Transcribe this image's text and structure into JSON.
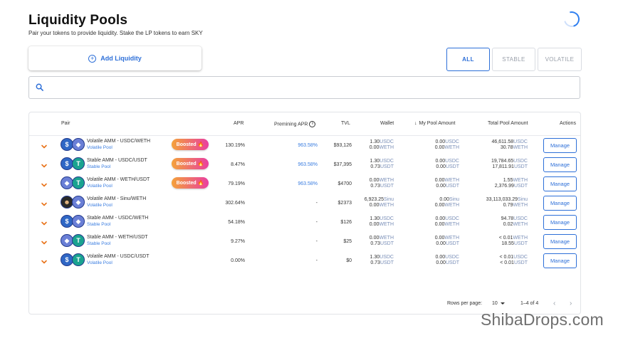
{
  "page": {
    "title": "Liquidity Pools",
    "subtitle": "Pair your tokens to provide liquidity. Stake the LP tokens to earn SKY"
  },
  "actions": {
    "add_liquidity": "Add Liquidity"
  },
  "filters": [
    "ALL",
    "STABLE",
    "VOLATILE"
  ],
  "search": {
    "placeholder": ""
  },
  "table": {
    "headers": {
      "pair": "Pair",
      "apr": "APR",
      "premining_apr": "Premining APR",
      "tvl": "TVL",
      "wallet": "Wallet",
      "my_pool": "My Pool Amount",
      "total_pool": "Total Pool Amount",
      "actions": "Actions"
    },
    "rows": [
      {
        "name": "Volatile AMM - USDC/WETH",
        "type": "Volatile Pool",
        "boosted": "Boosted",
        "tokens": [
          "usdc-icon",
          "weth-icon"
        ],
        "apr": "130.19%",
        "premining": "963.58%",
        "tvl": "$93,126",
        "wallet": [
          {
            "v": "1.30",
            "u": "USDC"
          },
          {
            "v": "0.00",
            "u": "WETH"
          }
        ],
        "my": [
          {
            "v": "0.00",
            "u": "USDC"
          },
          {
            "v": "0.00",
            "u": "WETH"
          }
        ],
        "total": [
          {
            "v": "46,611.58",
            "u": "USDC"
          },
          {
            "v": "30.78",
            "u": "WETH"
          }
        ],
        "manage": "Manage"
      },
      {
        "name": "Stable AMM - USDC/USDT",
        "type": "Stable Pool",
        "boosted": "Boosted",
        "tokens": [
          "usdc-icon",
          "usdt-icon"
        ],
        "apr": "8.47%",
        "premining": "963.58%",
        "tvl": "$37,395",
        "wallet": [
          {
            "v": "1.30",
            "u": "USDC"
          },
          {
            "v": "0.73",
            "u": "USDT"
          }
        ],
        "my": [
          {
            "v": "0.00",
            "u": "USDC"
          },
          {
            "v": "0.00",
            "u": "USDT"
          }
        ],
        "total": [
          {
            "v": "19,784.65",
            "u": "USDC"
          },
          {
            "v": "17,811.91",
            "u": "USDT"
          }
        ],
        "manage": "Manage"
      },
      {
        "name": "Volatile AMM - WETH/USDT",
        "type": "Volatile Pool",
        "boosted": "Boosted",
        "tokens": [
          "weth-icon",
          "usdt-icon"
        ],
        "apr": "79.19%",
        "premining": "963.58%",
        "tvl": "$4700",
        "wallet": [
          {
            "v": "0.00",
            "u": "WETH"
          },
          {
            "v": "0.73",
            "u": "USDT"
          }
        ],
        "my": [
          {
            "v": "0.00",
            "u": "WETH"
          },
          {
            "v": "0.00",
            "u": "USDT"
          }
        ],
        "total": [
          {
            "v": "1.55",
            "u": "WETH"
          },
          {
            "v": "2,376.99",
            "u": "USDT"
          }
        ],
        "manage": "Manage"
      },
      {
        "name": "Volatile AMM - Sinu/WETH",
        "type": "Volatile Pool",
        "boosted": "",
        "tokens": [
          "sinu-icon",
          "weth-icon"
        ],
        "apr": "302.64%",
        "premining": "-",
        "tvl": "$2373",
        "wallet": [
          {
            "v": "6,923.25",
            "u": "Sinu"
          },
          {
            "v": "0.00",
            "u": "WETH"
          }
        ],
        "my": [
          {
            "v": "0.00",
            "u": "Sinu"
          },
          {
            "v": "0.00",
            "u": "WETH"
          }
        ],
        "total": [
          {
            "v": "33,113,033.29",
            "u": "Sinu"
          },
          {
            "v": "0.79",
            "u": "WETH"
          }
        ],
        "manage": "Manage"
      },
      {
        "name": "Stable AMM - USDC/WETH",
        "type": "Stable Pool",
        "boosted": "",
        "tokens": [
          "usdc-icon",
          "weth-icon"
        ],
        "apr": "54.18%",
        "premining": "-",
        "tvl": "$126",
        "wallet": [
          {
            "v": "1.30",
            "u": "USDC"
          },
          {
            "v": "0.00",
            "u": "WETH"
          }
        ],
        "my": [
          {
            "v": "0.00",
            "u": "USDC"
          },
          {
            "v": "0.00",
            "u": "WETH"
          }
        ],
        "total": [
          {
            "v": "94.78",
            "u": "USDC"
          },
          {
            "v": "0.02",
            "u": "WETH"
          }
        ],
        "manage": "Manage"
      },
      {
        "name": "Stable AMM - WETH/USDT",
        "type": "Stable Pool",
        "boosted": "",
        "tokens": [
          "weth-icon",
          "usdt-icon"
        ],
        "apr": "9.27%",
        "premining": "-",
        "tvl": "$25",
        "wallet": [
          {
            "v": "0.00",
            "u": "WETH"
          },
          {
            "v": "0.73",
            "u": "USDT"
          }
        ],
        "my": [
          {
            "v": "0.00",
            "u": "WETH"
          },
          {
            "v": "0.00",
            "u": "USDT"
          }
        ],
        "total": [
          {
            "v": "< 0.01",
            "u": "WETH"
          },
          {
            "v": "18.55",
            "u": "USDT"
          }
        ],
        "manage": "Manage"
      },
      {
        "name": "Volatile AMM - USDC/USDT",
        "type": "Volatile Pool",
        "boosted": "",
        "tokens": [
          "usdc-icon",
          "usdt-icon"
        ],
        "apr": "0.00%",
        "premining": "-",
        "tvl": "$0",
        "wallet": [
          {
            "v": "1.30",
            "u": "USDC"
          },
          {
            "v": "0.73",
            "u": "USDT"
          }
        ],
        "my": [
          {
            "v": "0.00",
            "u": "USDC"
          },
          {
            "v": "0.00",
            "u": "USDT"
          }
        ],
        "total": [
          {
            "v": "< 0.01",
            "u": "USDC"
          },
          {
            "v": "< 0.01",
            "u": "USDT"
          }
        ],
        "manage": "Manage"
      }
    ]
  },
  "pagination": {
    "rows_per_page_label": "Rows per page:",
    "rows_per_page": "10",
    "range": "1–4 of 4"
  },
  "watermark": "ShibaDrops.com",
  "colors": {
    "accent": "#2d6fd8",
    "boosted_start": "#f4a23a",
    "boosted_end": "#e93fa0",
    "chevron": "#e8741c"
  }
}
